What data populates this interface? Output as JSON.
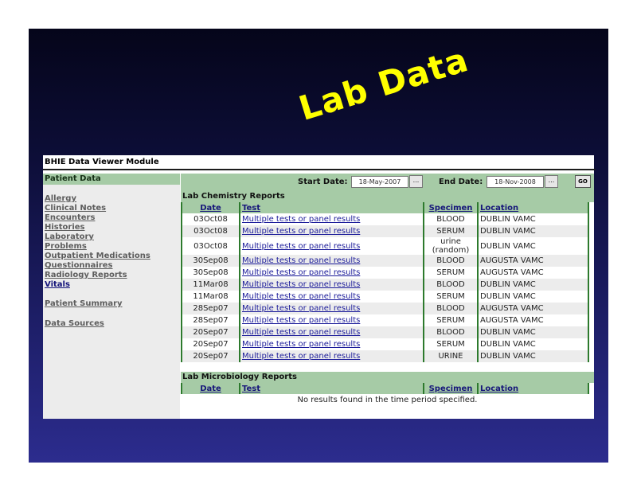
{
  "slide_title": "Lab Data",
  "app_title": "BHIE Data Viewer Module",
  "sidebar": {
    "header": "Patient Data",
    "items": [
      {
        "label": "Allergy"
      },
      {
        "label": "Clinical Notes"
      },
      {
        "label": "Encounters"
      },
      {
        "label": "Histories"
      },
      {
        "label": "Laboratory"
      },
      {
        "label": "Problems"
      },
      {
        "label": "Outpatient Medications"
      },
      {
        "label": "Questionnaires"
      },
      {
        "label": "Radiology Reports"
      },
      {
        "label": "Vitals"
      },
      {
        "label": "Patient Summary"
      },
      {
        "label": "Data Sources"
      }
    ]
  },
  "filters": {
    "start_label": "Start Date:",
    "start_value": "18-May-2007",
    "end_label": "End Date:",
    "end_value": "18-Nov-2008",
    "picker_label": "...",
    "go_label": "GO"
  },
  "chemistry": {
    "title": "Lab Chemistry Reports",
    "columns": [
      "Date",
      "Test",
      "Specimen",
      "Location"
    ],
    "rows": [
      [
        "03Oct08",
        "Multiple tests or panel results",
        "BLOOD",
        "DUBLIN VAMC"
      ],
      [
        "03Oct08",
        "Multiple tests or panel results",
        "SERUM",
        "DUBLIN VAMC"
      ],
      [
        "03Oct08",
        "Multiple tests or panel results",
        "urine (random)",
        "DUBLIN VAMC"
      ],
      [
        "30Sep08",
        "Multiple tests or panel results",
        "BLOOD",
        "AUGUSTA VAMC"
      ],
      [
        "30Sep08",
        "Multiple tests or panel results",
        "SERUM",
        "AUGUSTA VAMC"
      ],
      [
        "11Mar08",
        "Multiple tests or panel results",
        "BLOOD",
        "DUBLIN VAMC"
      ],
      [
        "11Mar08",
        "Multiple tests or panel results",
        "SERUM",
        "DUBLIN VAMC"
      ],
      [
        "28Sep07",
        "Multiple tests or panel results",
        "BLOOD",
        "AUGUSTA VAMC"
      ],
      [
        "28Sep07",
        "Multiple tests or panel results",
        "SERUM",
        "AUGUSTA VAMC"
      ],
      [
        "20Sep07",
        "Multiple tests or panel results",
        "BLOOD",
        "DUBLIN VAMC"
      ],
      [
        "20Sep07",
        "Multiple tests or panel results",
        "SERUM",
        "DUBLIN VAMC"
      ],
      [
        "20Sep07",
        "Multiple tests or panel results",
        "URINE",
        "DUBLIN VAMC"
      ]
    ]
  },
  "microbiology": {
    "title": "Lab Microbiology Reports",
    "columns": [
      "Date",
      "Test",
      "Specimen",
      "Location"
    ],
    "empty_message": "No results found in the time period specified."
  }
}
